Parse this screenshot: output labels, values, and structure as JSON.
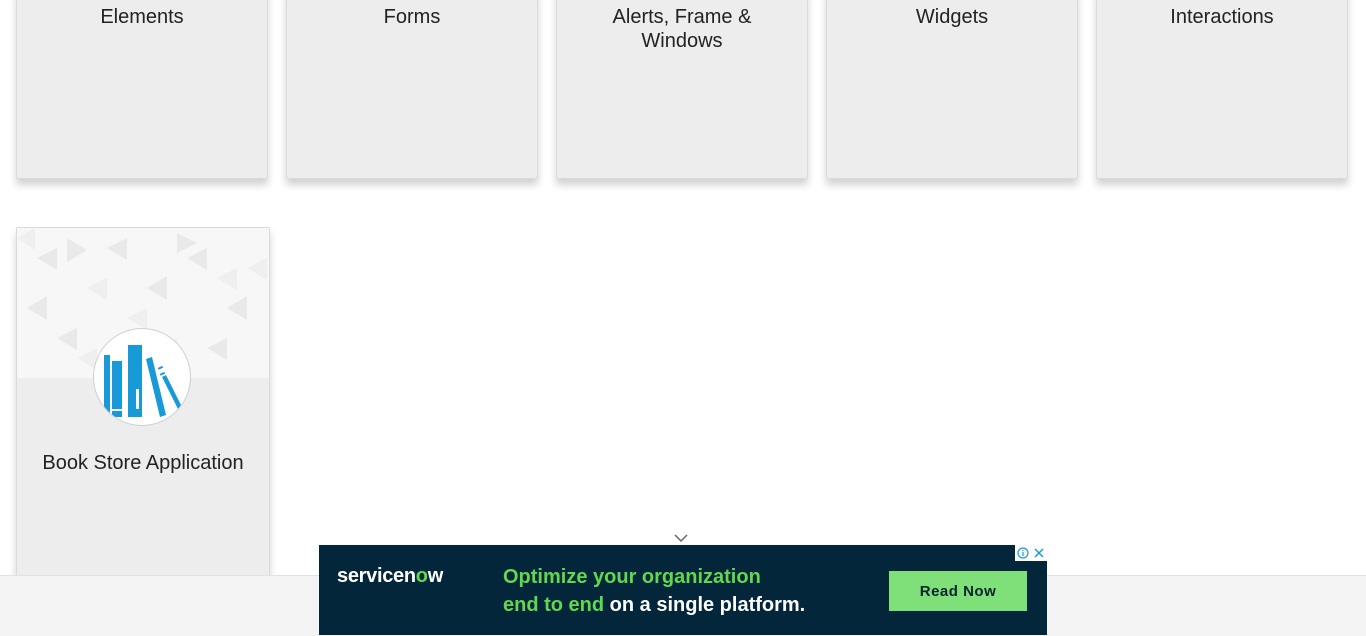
{
  "categories": [
    {
      "label": "Elements"
    },
    {
      "label": "Forms"
    },
    {
      "label": "Alerts, Frame & Windows"
    },
    {
      "label": "Widgets"
    },
    {
      "label": "Interactions"
    }
  ],
  "bookstore": {
    "label": "Book Store Application",
    "icon": "bookshelf-icon"
  },
  "ad": {
    "brand_prefix": "servicen",
    "brand_o": "o",
    "brand_suffix": "w",
    "headline_line1": "Optimize your organization",
    "headline_line2_green": "end to end",
    "headline_line2_white": " on a single platform.",
    "cta": "Read Now",
    "brand_green": "#62d84e",
    "bg": "#03263a"
  },
  "colors": {
    "card_bg": "#ededed",
    "icon_blue": "#189ad9"
  }
}
